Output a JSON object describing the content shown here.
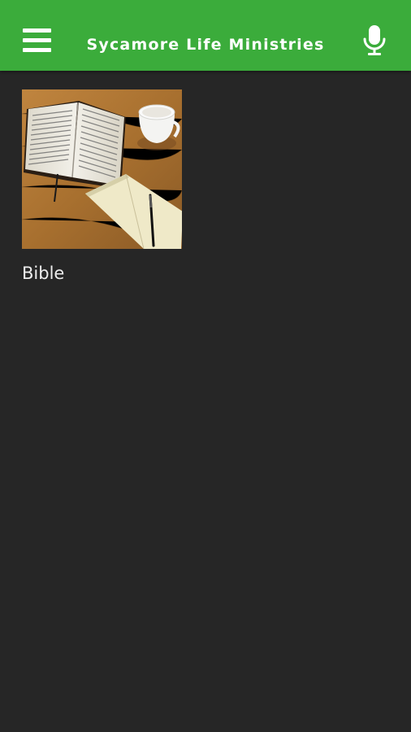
{
  "header": {
    "title": "Sycamore Life Ministries",
    "menu_icon": "hamburger-menu-icon",
    "mic_icon": "microphone-icon",
    "background_color": "#3BAC3B"
  },
  "content": {
    "items": [
      {
        "label": "Bible",
        "image": "open bible, notebook, pen and coffee cup on wooden table"
      }
    ]
  },
  "colors": {
    "page_background": "#262626",
    "label_text": "#ededed"
  }
}
